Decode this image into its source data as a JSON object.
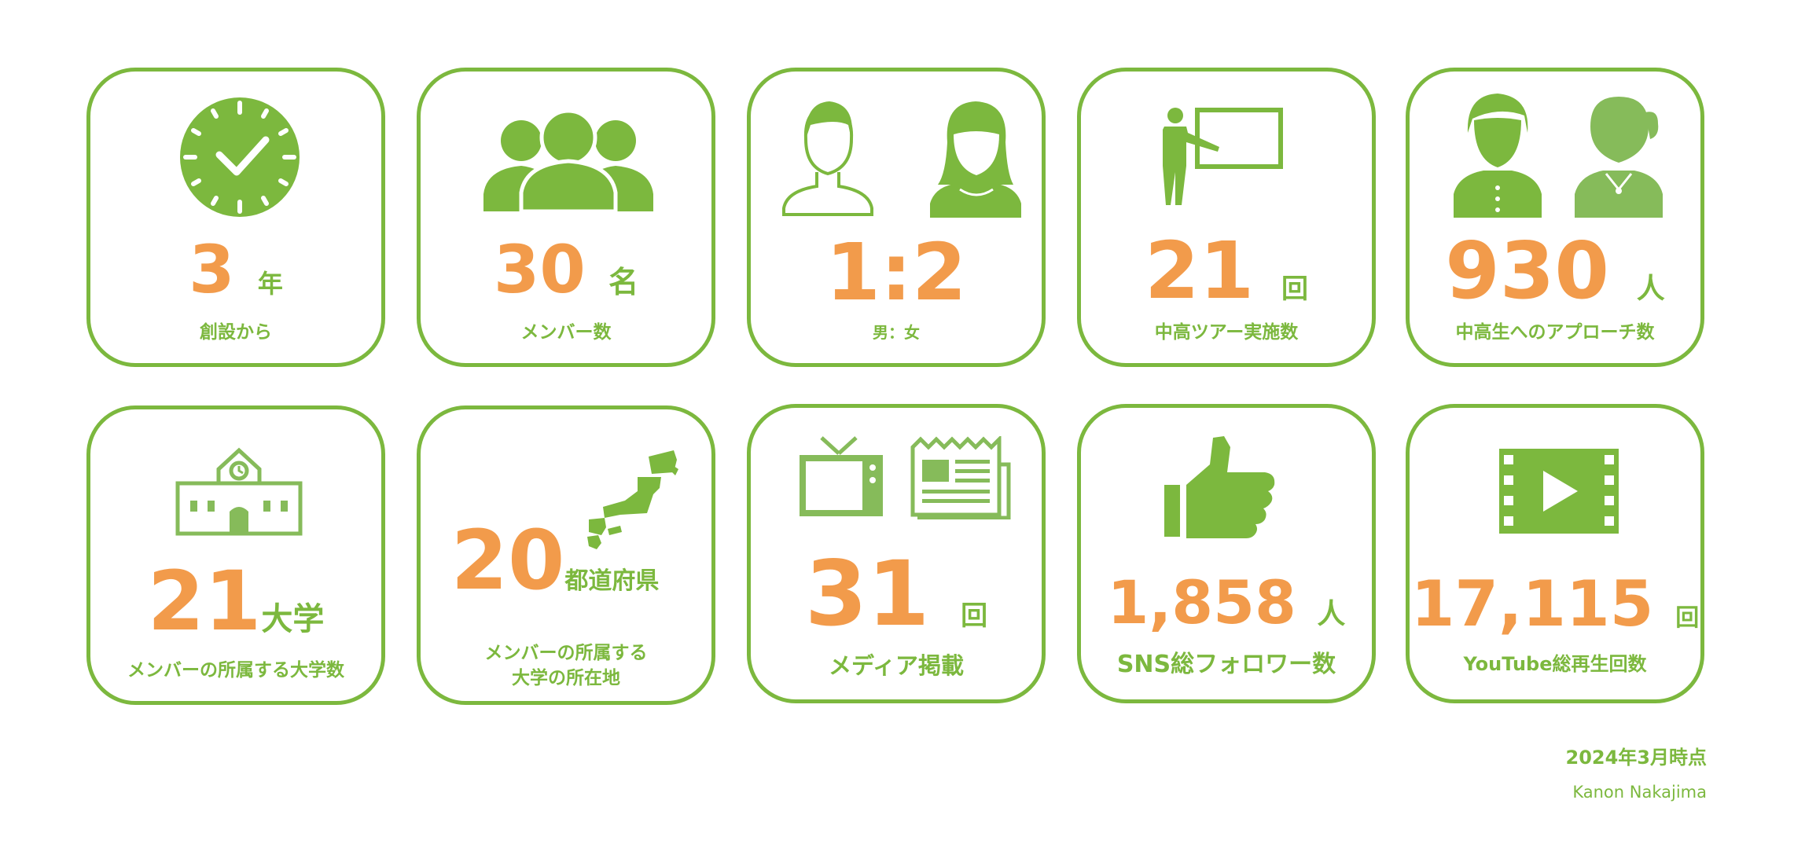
{
  "colors": {
    "green": "#7cb83e",
    "green_light": "#86bb5a",
    "orange": "#f29b4b"
  },
  "stats": [
    {
      "value": "3",
      "unit": "年",
      "label": "創設から",
      "icon": "clock-icon"
    },
    {
      "value": "30",
      "unit": "名",
      "label": "メンバー数",
      "icon": "group-icon"
    },
    {
      "value": "1:2",
      "unit": "",
      "label": "男：女",
      "icon": "male-female-icon"
    },
    {
      "value": "21",
      "unit": "回",
      "label": "中高ツアー実施数",
      "icon": "presenter-icon"
    },
    {
      "value": "930",
      "unit": "人",
      "label": "中高生へのアプローチ数",
      "icon": "students-icon"
    },
    {
      "value": "21",
      "unit": "大学",
      "label": "メンバーの所属する大学数",
      "icon": "school-icon"
    },
    {
      "value": "20",
      "unit": "都道府県",
      "label_line1": "メンバーの所属する",
      "label_line2": "大学の所在地",
      "icon": "japan-map-icon"
    },
    {
      "value": "31",
      "unit": "回",
      "label": "メディア掲載",
      "icon": "tv-newspaper-icon"
    },
    {
      "value": "1,858",
      "unit": "人",
      "label": "SNS総フォロワー数",
      "icon": "thumbs-up-icon"
    },
    {
      "value": "17,115",
      "unit": "回",
      "label": "YouTube総再生回数",
      "icon": "video-icon"
    }
  ],
  "footer": {
    "date": "2024年3月時点",
    "author": "Kanon Nakajima"
  }
}
